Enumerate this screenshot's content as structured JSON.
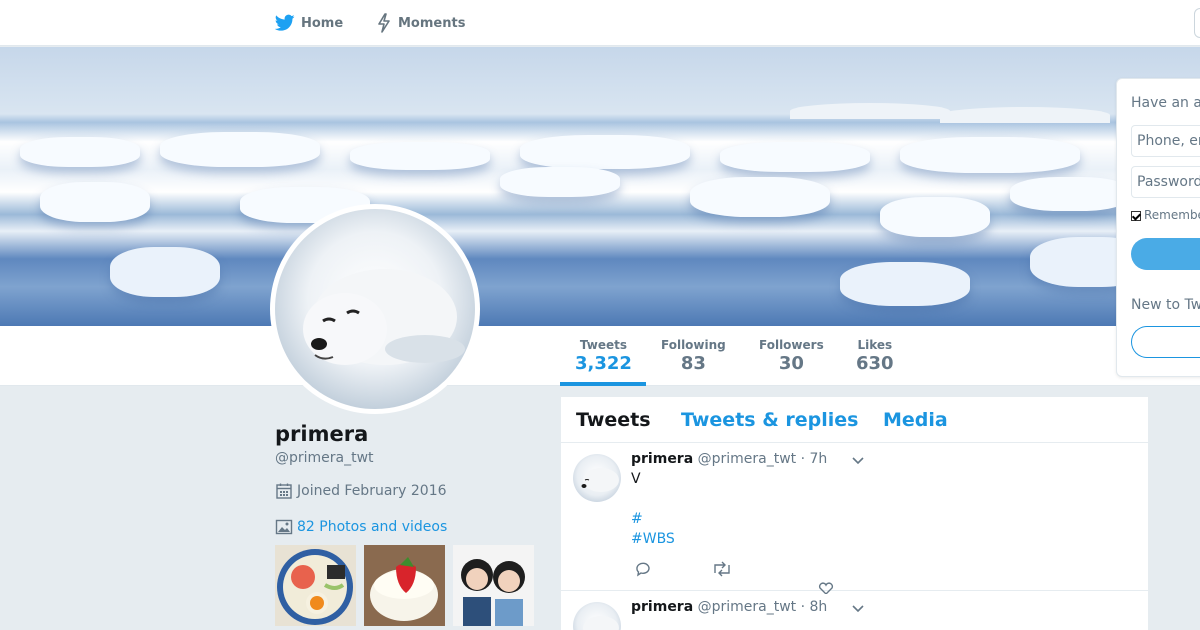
{
  "nav": {
    "home_label": "Home",
    "moments_label": "Moments"
  },
  "profile": {
    "name": "primera",
    "handle": "@primera_twt",
    "joined": "Joined February 2016",
    "photos_link": "82 Photos and videos"
  },
  "stats": [
    {
      "label": "Tweets",
      "value": "3,322",
      "active": true
    },
    {
      "label": "Following",
      "value": "83"
    },
    {
      "label": "Followers",
      "value": "30"
    },
    {
      "label": "Likes",
      "value": "630"
    }
  ],
  "timeline": {
    "tabs": [
      "Tweets",
      "Tweets & replies",
      "Media"
    ],
    "tweets": [
      {
        "name": "primera",
        "handle": "@primera_twt",
        "time": "· 7h",
        "text": "V",
        "hashtags": [
          "#",
          "#WBS"
        ]
      },
      {
        "name": "primera",
        "handle": "@primera_twt",
        "time": "· 8h"
      }
    ]
  },
  "login": {
    "title": "Have an a",
    "phone_placeholder": "Phone, er",
    "password_placeholder": "Password",
    "remember_label": "Remember",
    "new_to": "New to Tw"
  },
  "colors": {
    "accent": "#1b95e0",
    "background": "#e6ecf0"
  }
}
